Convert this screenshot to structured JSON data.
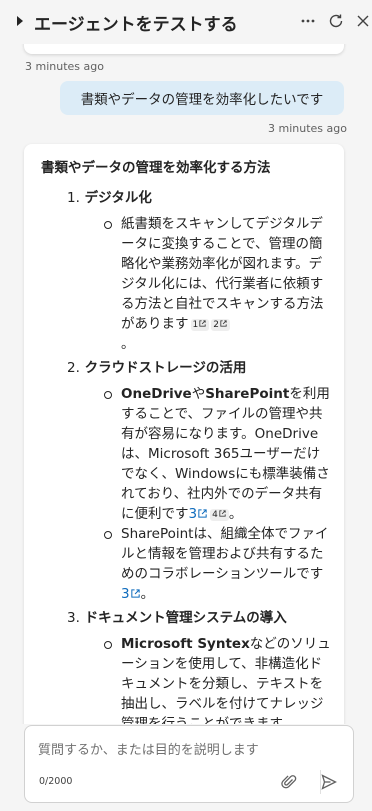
{
  "header": {
    "title": "エージェントをテストする",
    "more_icon": "more-horizontal-icon",
    "refresh_icon": "refresh-icon",
    "close_icon": "close-icon"
  },
  "conversation": {
    "prev_timestamp": "3 minutes ago",
    "user_message": "書類やデータの管理を効率化したいです",
    "user_timestamp": "3 minutes ago",
    "bot_heading": "書類やデータの管理を効率化する方法",
    "sections": [
      {
        "num": "1.",
        "title": "デジタル化",
        "paragraph_text": "紙書類をスキャンしてデジタルデータに変換することで、管理の簡略化や業務効率化が図れます。デジタル化には、代行業者に依頼する方法と自社でスキャンする方法があります",
        "citations": [
          "1",
          "2"
        ],
        "trailing": "。"
      },
      {
        "num": "2.",
        "title": "クラウドストレージの活用",
        "p1_bold1": "OneDrive",
        "p1_mid": "や",
        "p1_bold2": "SharePoint",
        "p1_text": "を利用することで、ファイルの管理や共有が容易になります。OneDriveは、Microsoft 365ユーザーだけでなく、Windowsにも標準装備されており、社内外でのデータ共有に便利です",
        "p1_link": "3",
        "p1_cite": "4",
        "p1_trailing": "。",
        "p2_text": "SharePointは、組織全体でファイルと情報を管理および共有するためのコラボレーションツールです",
        "p2_link": "3",
        "p2_trailing": "。"
      },
      {
        "num": "3.",
        "title": "ドキュメント管理システムの導入",
        "p_bold": "Microsoft Syntex",
        "p_text": "などのソリューションを使用して、非構造化ドキュメントを分類し、テキストを抽出し、ラベルを付けてナレッジ管理を行うことができます。"
      }
    ]
  },
  "composer": {
    "placeholder": "質問するか、または目的を説明します",
    "value": "",
    "counter": "0/2000",
    "attach_icon": "paperclip-icon",
    "send_icon": "send-icon"
  },
  "colors": {
    "user_bubble": "#dcecf7",
    "link": "#0f6cbd",
    "background": "#f5f5f5"
  }
}
